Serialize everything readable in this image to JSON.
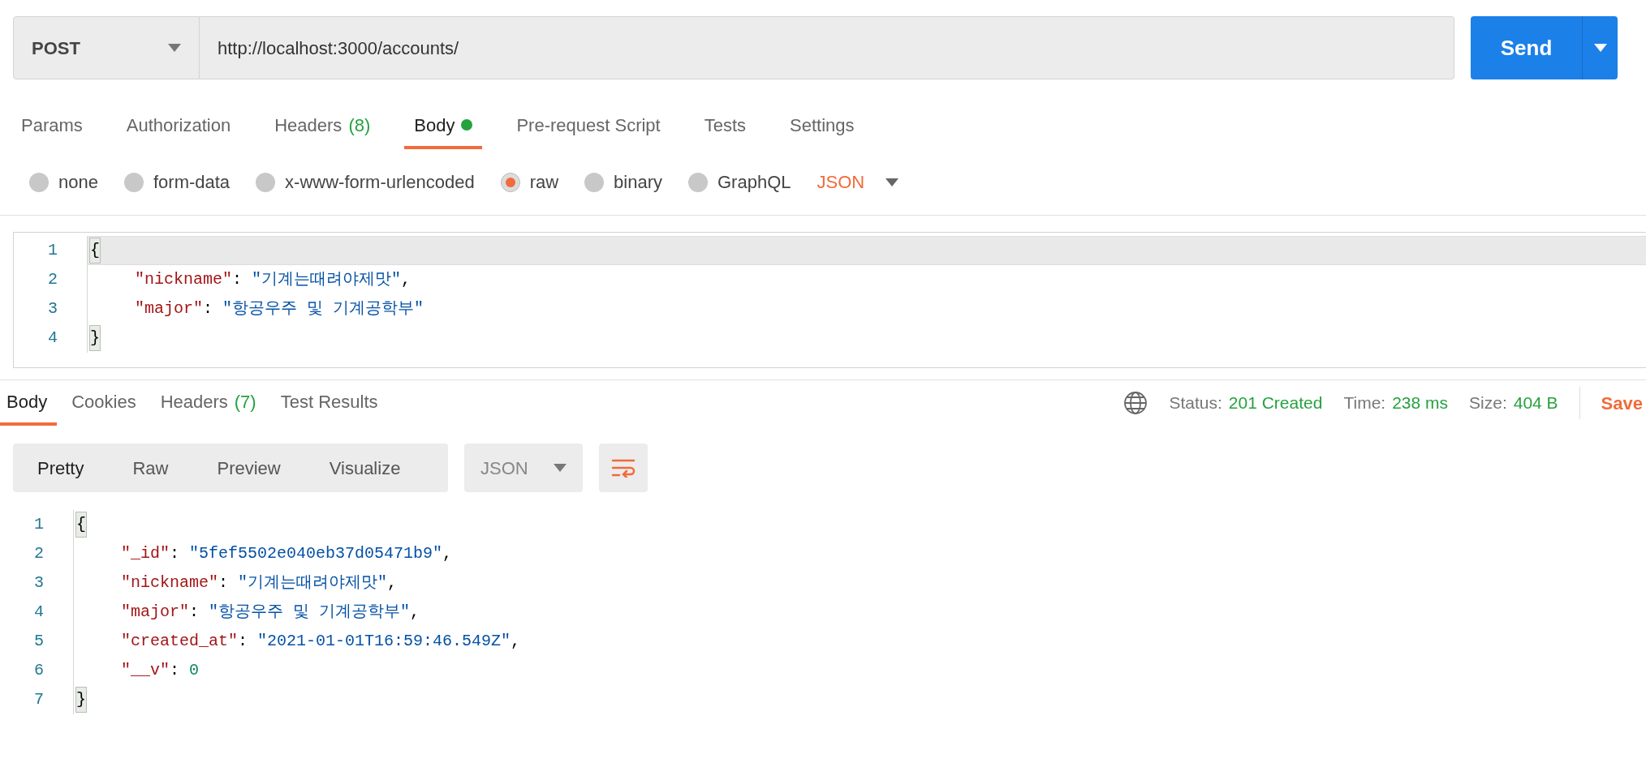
{
  "request": {
    "method": "POST",
    "url": "http://localhost:3000/accounts/",
    "send_label": "Send"
  },
  "request_tabs": [
    {
      "label": "Params",
      "selected": false
    },
    {
      "label": "Authorization",
      "selected": false
    },
    {
      "label": "Headers",
      "count": "(8)",
      "selected": false
    },
    {
      "label": "Body",
      "selected": true,
      "dot": true
    },
    {
      "label": "Pre-request Script",
      "selected": false
    },
    {
      "label": "Tests",
      "selected": false
    },
    {
      "label": "Settings",
      "selected": false
    }
  ],
  "body_types": [
    {
      "label": "none",
      "selected": false
    },
    {
      "label": "form-data",
      "selected": false
    },
    {
      "label": "x-www-form-urlencoded",
      "selected": false
    },
    {
      "label": "raw",
      "selected": true
    },
    {
      "label": "binary",
      "selected": false
    },
    {
      "label": "GraphQL",
      "selected": false
    }
  ],
  "raw_format": "JSON",
  "request_body": [
    {
      "number": "1",
      "kind": "brace",
      "active": true,
      "tokens": [
        {
          "kind": "bracket",
          "text": "{"
        }
      ]
    },
    {
      "number": "2",
      "kind": "member",
      "active": false,
      "tokens": [
        {
          "kind": "key",
          "text": "\"nickname\""
        },
        {
          "kind": "punct",
          "text": ": "
        },
        {
          "kind": "string",
          "text": "\"기계는때려야제맛\""
        },
        {
          "kind": "punct",
          "text": ","
        }
      ]
    },
    {
      "number": "3",
      "kind": "member",
      "active": false,
      "tokens": [
        {
          "kind": "key",
          "text": "\"major\""
        },
        {
          "kind": "punct",
          "text": ": "
        },
        {
          "kind": "string",
          "text": "\"항공우주 및 기계공학부\""
        }
      ]
    },
    {
      "number": "4",
      "kind": "brace",
      "active": false,
      "tokens": [
        {
          "kind": "bracket",
          "text": "}"
        }
      ]
    }
  ],
  "response_tabs": [
    {
      "label": "Body",
      "selected": true
    },
    {
      "label": "Cookies",
      "selected": false
    },
    {
      "label": "Headers",
      "count": "(7)",
      "selected": false
    },
    {
      "label": "Test Results",
      "selected": false
    }
  ],
  "status": [
    {
      "label": "Status:",
      "value": "201 Created"
    },
    {
      "label": "Time:",
      "value": "238 ms"
    },
    {
      "label": "Size:",
      "value": "404 B"
    }
  ],
  "save_label": "Save",
  "view_modes": [
    {
      "label": "Pretty",
      "selected": true
    },
    {
      "label": "Raw",
      "selected": false
    },
    {
      "label": "Preview",
      "selected": false
    },
    {
      "label": "Visualize",
      "selected": false
    }
  ],
  "response_format": "JSON",
  "response_body": [
    {
      "number": "1",
      "kind": "brace",
      "tokens": [
        {
          "kind": "bracket",
          "text": "{"
        }
      ]
    },
    {
      "number": "2",
      "kind": "member",
      "tokens": [
        {
          "kind": "key",
          "text": "\"_id\""
        },
        {
          "kind": "punct",
          "text": ": "
        },
        {
          "kind": "string",
          "text": "\"5fef5502e040eb37d05471b9\""
        },
        {
          "kind": "punct",
          "text": ","
        }
      ]
    },
    {
      "number": "3",
      "kind": "member",
      "tokens": [
        {
          "kind": "key",
          "text": "\"nickname\""
        },
        {
          "kind": "punct",
          "text": ": "
        },
        {
          "kind": "string",
          "text": "\"기계는때려야제맛\""
        },
        {
          "kind": "punct",
          "text": ","
        }
      ]
    },
    {
      "number": "4",
      "kind": "member",
      "tokens": [
        {
          "kind": "key",
          "text": "\"major\""
        },
        {
          "kind": "punct",
          "text": ": "
        },
        {
          "kind": "string",
          "text": "\"항공우주 및 기계공학부\""
        },
        {
          "kind": "punct",
          "text": ","
        }
      ]
    },
    {
      "number": "5",
      "kind": "member",
      "tokens": [
        {
          "kind": "key",
          "text": "\"created_at\""
        },
        {
          "kind": "punct",
          "text": ": "
        },
        {
          "kind": "string",
          "text": "\"2021-01-01T16:59:46.549Z\""
        },
        {
          "kind": "punct",
          "text": ","
        }
      ]
    },
    {
      "number": "6",
      "kind": "member",
      "tokens": [
        {
          "kind": "key",
          "text": "\"__v\""
        },
        {
          "kind": "punct",
          "text": ": "
        },
        {
          "kind": "number",
          "text": "0"
        }
      ]
    },
    {
      "number": "7",
      "kind": "brace",
      "tokens": [
        {
          "kind": "bracket",
          "text": "}"
        }
      ]
    }
  ]
}
